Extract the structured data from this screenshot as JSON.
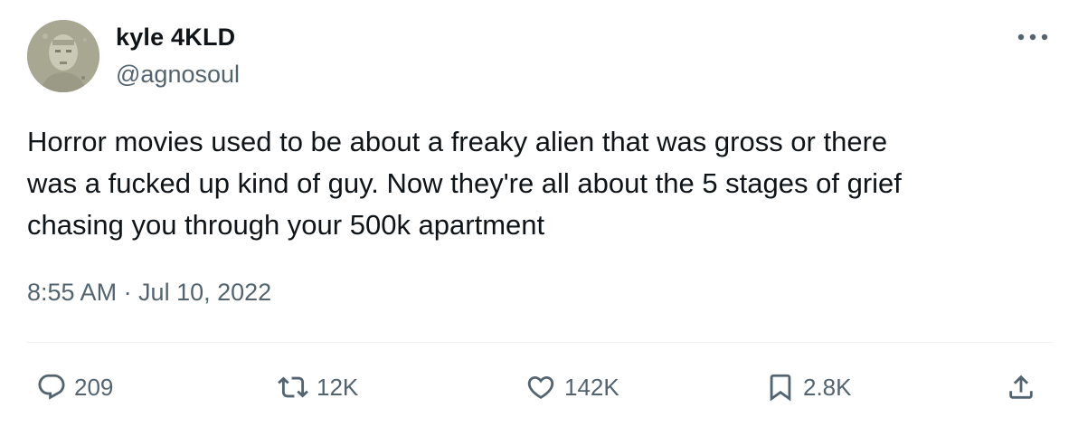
{
  "author": {
    "display_name": "kyle 4KLD",
    "handle": "@agnosoul",
    "avatar_icon": "avatar-image"
  },
  "tweet": {
    "lines": [
      "Horror movies used to be about a freaky alien that was gross or there",
      "was a fucked up kind of guy. Now they're all about the 5 stages of grief",
      "chasing you through your 500k apartment"
    ],
    "timestamp": "8:55 AM · Jul 10, 2022"
  },
  "actions": {
    "replies": "209",
    "retweets": "12K",
    "likes": "142K",
    "bookmarks": "2.8K"
  },
  "icons": {
    "more": "more-icon",
    "reply": "reply-icon",
    "retweet": "retweet-icon",
    "like": "heart-icon",
    "bookmark": "bookmark-icon",
    "share": "share-icon"
  },
  "colors": {
    "text_primary": "#0f1419",
    "text_secondary": "#536471",
    "divider": "#eff3f4"
  }
}
